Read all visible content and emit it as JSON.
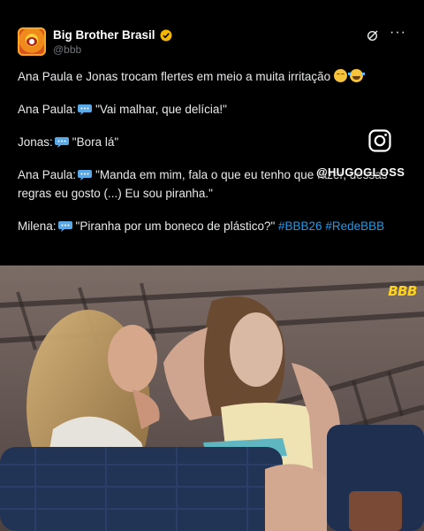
{
  "account": {
    "display_name": "Big Brother Brasil",
    "handle": "@bbb",
    "verified_color": "#f4b400"
  },
  "tweet": {
    "lines": [
      {
        "id": "headline",
        "text": "Ana Paula e Jonas trocam flertes em meio a muita irritação",
        "emojis": [
          "relieved-face",
          "tears-of-joy"
        ]
      },
      {
        "id": "ana1",
        "speaker": "Ana Paula:",
        "quote": "\"Vai malhar, que delícia!\""
      },
      {
        "id": "jonas",
        "speaker": "Jonas:",
        "quote": "\"Bora lá\""
      },
      {
        "id": "ana2",
        "speaker": "Ana Paula:",
        "quote": "\"Manda em mim, fala o que eu tenho que fazer, dessas",
        "quote_cont": "regras eu gosto (...) Eu sou piranha.\""
      },
      {
        "id": "milena",
        "speaker": "Milena:",
        "quote": "\"Piranha por um boneco de plástico?\"",
        "hashtags": "#BBB26 #RedeBBB"
      }
    ],
    "hashtag_color": "#1d9bf0"
  },
  "overlay": {
    "watermark": "@HUGOGLOSS",
    "instagram": "instagram-icon"
  },
  "video": {
    "channel_logo": "BBB"
  }
}
